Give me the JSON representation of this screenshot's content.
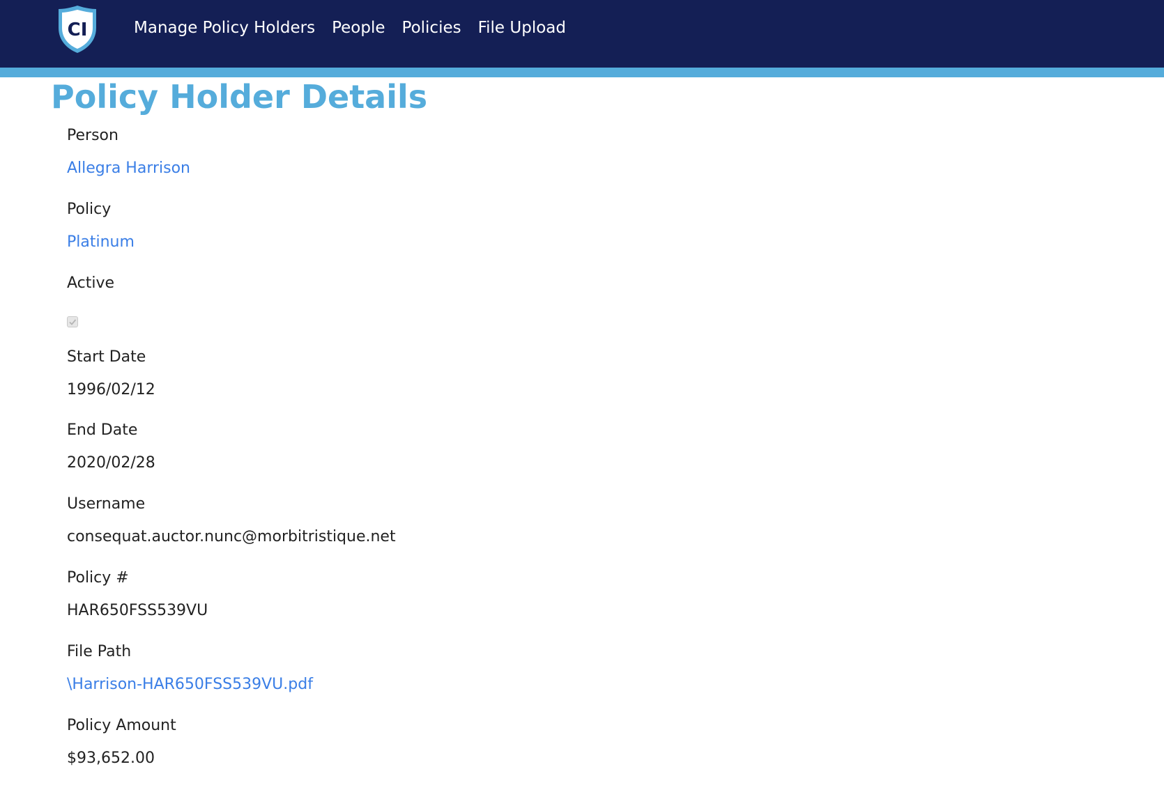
{
  "nav": {
    "logo_text": "CI",
    "links": [
      "Manage Policy Holders",
      "People",
      "Policies",
      "File Upload"
    ]
  },
  "page": {
    "title": "Policy Holder Details"
  },
  "details": {
    "person": {
      "label": "Person",
      "value": "Allegra Harrison"
    },
    "policy": {
      "label": "Policy",
      "value": "Platinum"
    },
    "active": {
      "label": "Active",
      "checked": true
    },
    "start_date": {
      "label": "Start Date",
      "value": "1996/02/12"
    },
    "end_date": {
      "label": "End Date",
      "value": "2020/02/28"
    },
    "username": {
      "label": "Username",
      "value": "consequat.auctor.nunc@morbitristique.net"
    },
    "policy_number": {
      "label": "Policy #",
      "value": "HAR650FSS539VU"
    },
    "file_path": {
      "label": "File Path",
      "value": "\\Harrison-HAR650FSS539VU.pdf"
    },
    "policy_amount": {
      "label": "Policy Amount",
      "value": "$93,652.00"
    }
  },
  "colors": {
    "navbar": "#141f55",
    "accent": "#55acdb",
    "link": "#3a7ee6",
    "text": "#222222"
  },
  "icons": {
    "logo": "shield-logo-icon",
    "checkbox": "checkmark-icon"
  }
}
